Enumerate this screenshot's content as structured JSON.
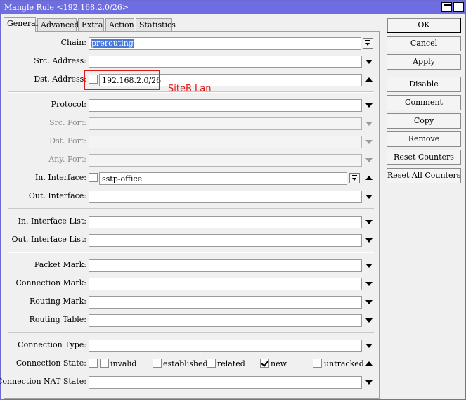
{
  "window": {
    "title": "Mangle Rule <192.168.2.0/26>",
    "close_glyph": "✕"
  },
  "tabs": [
    "General",
    "Advanced",
    "Extra",
    "Action",
    "Statistics"
  ],
  "form": {
    "chain": {
      "label": "Chain:",
      "value": "prerouting"
    },
    "src_address": {
      "label": "Src. Address:",
      "value": ""
    },
    "dst_address": {
      "label": "Dst. Address:",
      "value": "192.168.2.0/26",
      "negate": false
    },
    "protocol": {
      "label": "Protocol:",
      "value": ""
    },
    "src_port": {
      "label": "Src. Port:",
      "value": ""
    },
    "dst_port": {
      "label": "Dst. Port:",
      "value": ""
    },
    "any_port": {
      "label": "Any. Port:",
      "value": ""
    },
    "in_interface": {
      "label": "In. Interface:",
      "value": "sstp-office",
      "negate": false
    },
    "out_interface": {
      "label": "Out. Interface:",
      "value": ""
    },
    "in_interface_list": {
      "label": "In. Interface List:",
      "value": ""
    },
    "out_interface_list": {
      "label": "Out. Interface List:",
      "value": ""
    },
    "packet_mark": {
      "label": "Packet Mark:",
      "value": ""
    },
    "connection_mark": {
      "label": "Connection Mark:",
      "value": ""
    },
    "routing_mark": {
      "label": "Routing Mark:",
      "value": ""
    },
    "routing_table": {
      "label": "Routing Table:",
      "value": ""
    },
    "connection_type": {
      "label": "Connection Type:",
      "value": ""
    },
    "connection_state": {
      "label": "Connection State:",
      "options": [
        {
          "label": "invalid",
          "checked": false
        },
        {
          "label": "established",
          "checked": false
        },
        {
          "label": "related",
          "checked": false
        },
        {
          "label": "new",
          "checked": true
        },
        {
          "label": "untracked",
          "checked": false
        }
      ]
    },
    "connection_nat_state": {
      "label": "Connection NAT State:",
      "value": ""
    }
  },
  "buttons": [
    "OK",
    "Cancel",
    "Apply",
    "Disable",
    "Comment",
    "Copy",
    "Remove",
    "Reset Counters",
    "Reset All Counters"
  ],
  "annotation": {
    "text": "SiteB Lan",
    "color": "#e01818"
  },
  "colors": {
    "titlebar": "#6e6ee2",
    "selection": "#4a78d8"
  }
}
